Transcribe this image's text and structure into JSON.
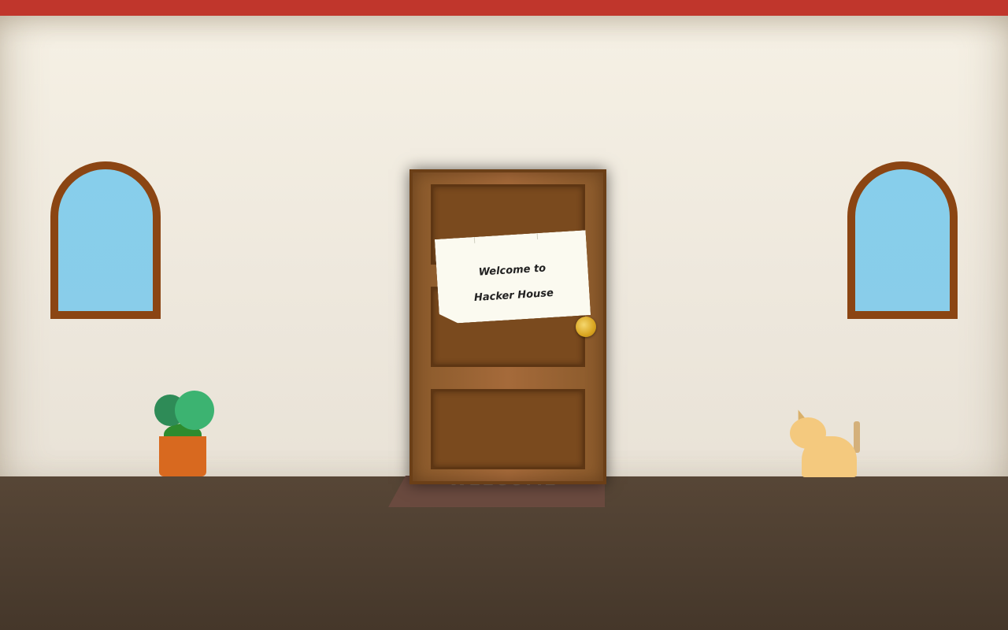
{
  "scene": {
    "door_note": {
      "line1": "Welcome to",
      "line2": "Hacker House"
    },
    "doormat_text": "WELCOME"
  },
  "colors": {
    "top_bar": "#c0362c",
    "wall": "#f0eade",
    "floor": "#4e3f31",
    "door_wood": "#a0652f",
    "door_panel": "#7a4a1e",
    "window_frame": "#8b4513",
    "window_glass": "#87ceeb",
    "knob": "#d9a520",
    "pot": "#d8691f",
    "leaves": "#3cb371",
    "cat": "#f4c97e"
  },
  "icons": [
    "door",
    "door-knob",
    "note",
    "doormat",
    "window",
    "potted-plant",
    "cat"
  ]
}
